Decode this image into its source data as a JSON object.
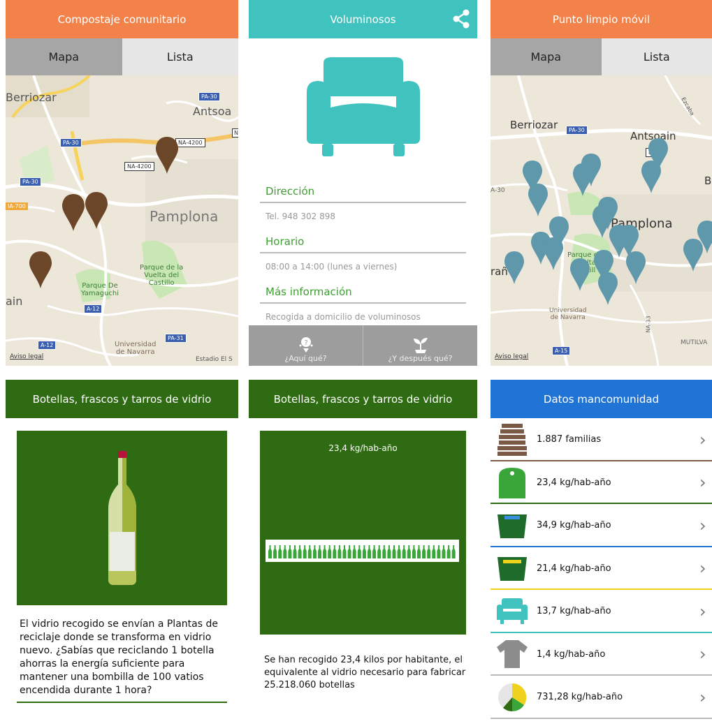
{
  "screen1": {
    "title": "Compostaje comunitario",
    "tabs": [
      "Mapa",
      "Lista"
    ],
    "map_labels": {
      "berriozar": "Berriozar",
      "antsoa": "Antsoa",
      "pamplona": "Pamplona",
      "parque_vuelta": "Parque de la\nVuelta del\nCastillo",
      "parque_yamaguchi": "Parque De\nYamaguchi",
      "universidad": "Universidad\nde Navarra",
      "ain": "ain",
      "estadio": "Estadio El S",
      "pa30a": "PA-30",
      "pa30b": "PA-30",
      "pa30c": "PA-30",
      "na4200a": "NA-4200",
      "na4200b": "NA-4200",
      "a700": "IA-700",
      "a12a": "A-12",
      "a12b": "A-12",
      "pa31": "PA-31",
      "n": "N"
    },
    "aviso": "Aviso legal",
    "pin_color": "#6b4628"
  },
  "screen2": {
    "title": "Voluminosos",
    "rows": [
      {
        "head": "Dirección",
        "value": "Tel. 948 302 898"
      },
      {
        "head": "Horario",
        "value": "08:00 a 14:00 (lunes a viernes)"
      },
      {
        "head": "Más información",
        "value": "Recogida a domicilio de voluminosos"
      }
    ],
    "bottom": [
      "¿Aquí qué?",
      "¿Y después qué?"
    ],
    "accent": "#40c3be"
  },
  "screen3": {
    "title": "Punto limpio móvil",
    "tabs": [
      "Mapa",
      "Lista"
    ],
    "map_labels": {
      "berriozar": "Berriozar",
      "antsoain": "Antsoain",
      "pamplona": "Pamplona",
      "parque": "Parque de\nVuelta\nCastill",
      "universidad": "Universidad\nde Navarra",
      "ezcaba": "Ezcaba",
      "mutilva": "MUTILVA",
      "rana": "rañ",
      "b": "B",
      "na33": "NA-33",
      "pa30": "PA-30",
      "a15": "A-15",
      "na": "NA",
      "a30": "A-30"
    },
    "aviso": "Aviso legal",
    "pin_color": "#5f97ab"
  },
  "screen4": {
    "title": "Botellas, frascos y tarros de vidrio",
    "paragraph": "El vidrio recogido se envían a Plantas de reciclaje donde se transforma en vidrio nuevo. ¿Sabías que reciclando 1 botella ahorras la energía suficiente para mantener una bombilla de 100 vatios encendida durante 1 hora?"
  },
  "screen5": {
    "title": "Botellas, frascos y tarros de vidrio",
    "kg": "23,4 kg/hab-año",
    "paragraph": "Se han recogido 23,4 kilos por habitante, el equivalente al vidrio necesario para fabricar 25.218.060 botellas"
  },
  "screen6": {
    "title": "Datos mancomunidad",
    "rows": [
      {
        "text": "1.887 familias",
        "icon": "stack-icon",
        "color": "#7a5a45"
      },
      {
        "text": "23,4 kg/hab-año",
        "icon": "glass-container-icon",
        "color": "#2e6b12"
      },
      {
        "text": "34,9 kg/hab-año",
        "icon": "blue-bin-icon",
        "color": "#1f74d6"
      },
      {
        "text": "21,4 kg/hab-año",
        "icon": "yellow-bin-icon",
        "color": "#f0d21e"
      },
      {
        "text": "13,7 kg/hab-año",
        "icon": "sofa-icon",
        "color": "#40c3be"
      },
      {
        "text": "1,4 kg/hab-año",
        "icon": "tshirt-icon",
        "color": "#8c8c8c"
      },
      {
        "text": "731,28 kg/hab-año",
        "icon": "pie-icon",
        "color": "#bbbbbb"
      }
    ]
  }
}
